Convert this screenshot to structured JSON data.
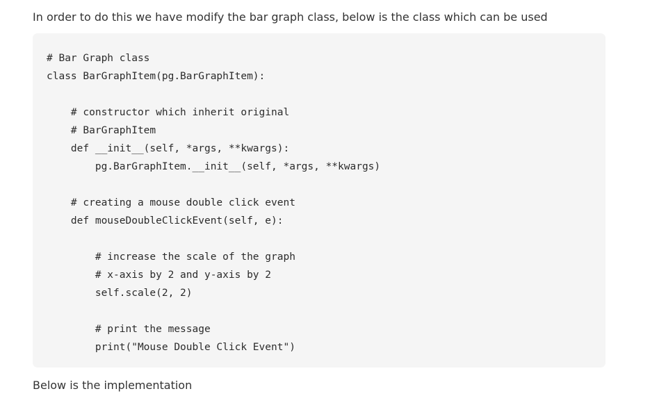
{
  "intro_text": "In order to do this we have modify the bar graph class, below is the class which can be used",
  "code_lines": [
    "# Bar Graph class",
    "class BarGraphItem(pg.BarGraphItem):",
    "",
    "    # constructor which inherit original",
    "    # BarGraphItem",
    "    def __init__(self, *args, **kwargs):",
    "        pg.BarGraphItem.__init__(self, *args, **kwargs)",
    "",
    "    # creating a mouse double click event",
    "    def mouseDoubleClickEvent(self, e):",
    "",
    "        # increase the scale of the graph",
    "        # x-axis by 2 and y-axis by 2",
    "        self.scale(2, 2)",
    "",
    "        # print the message",
    "        print(\"Mouse Double Click Event\")"
  ],
  "outro_text": "Below is the implementation"
}
